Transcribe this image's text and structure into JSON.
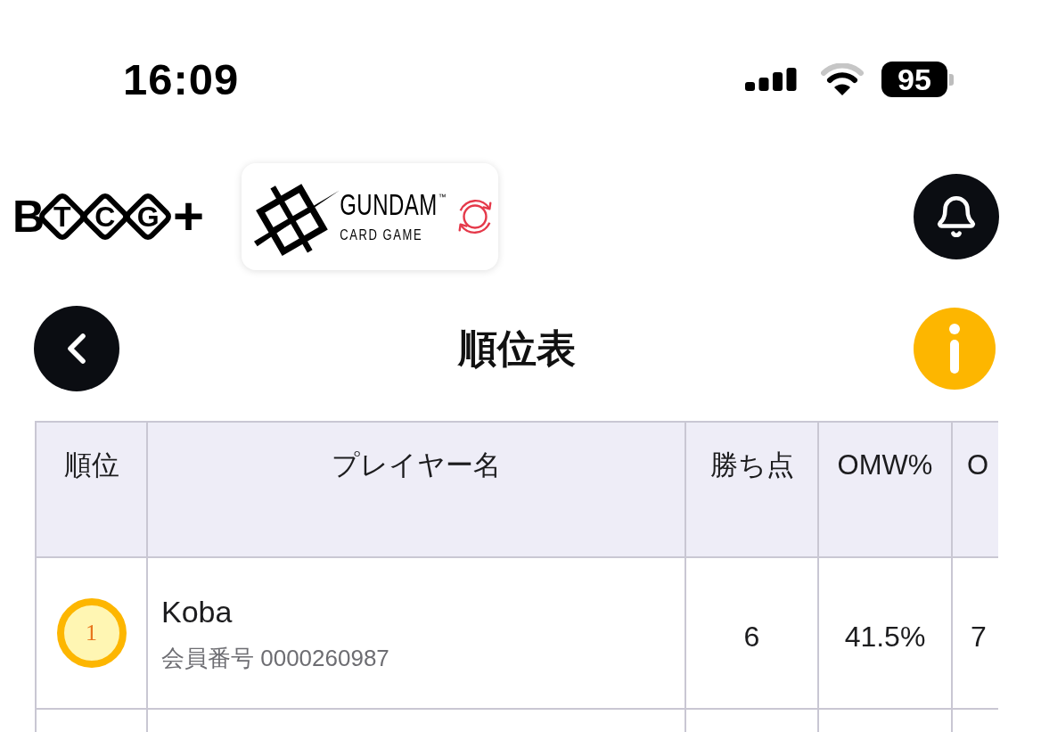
{
  "status_bar": {
    "time": "16:09",
    "battery": "95"
  },
  "header": {
    "brand": {
      "initial": "B",
      "tiles": [
        "T",
        "C",
        "G"
      ],
      "suffix": "+"
    },
    "game_logo": {
      "title": "GUNDAM",
      "trademark": "™",
      "subtitle": "CARD GAME"
    }
  },
  "page": {
    "title": "順位表"
  },
  "table": {
    "columns": [
      "順位",
      "プレイヤー名",
      "勝ち点",
      "OMW%",
      "O"
    ],
    "rows": [
      {
        "rank": "1",
        "color": "#fdb600",
        "name": "Koba",
        "member_id": "会員番号 0000260987",
        "points": "6",
        "omw": "41.5%",
        "column_5": "7"
      }
    ]
  }
}
